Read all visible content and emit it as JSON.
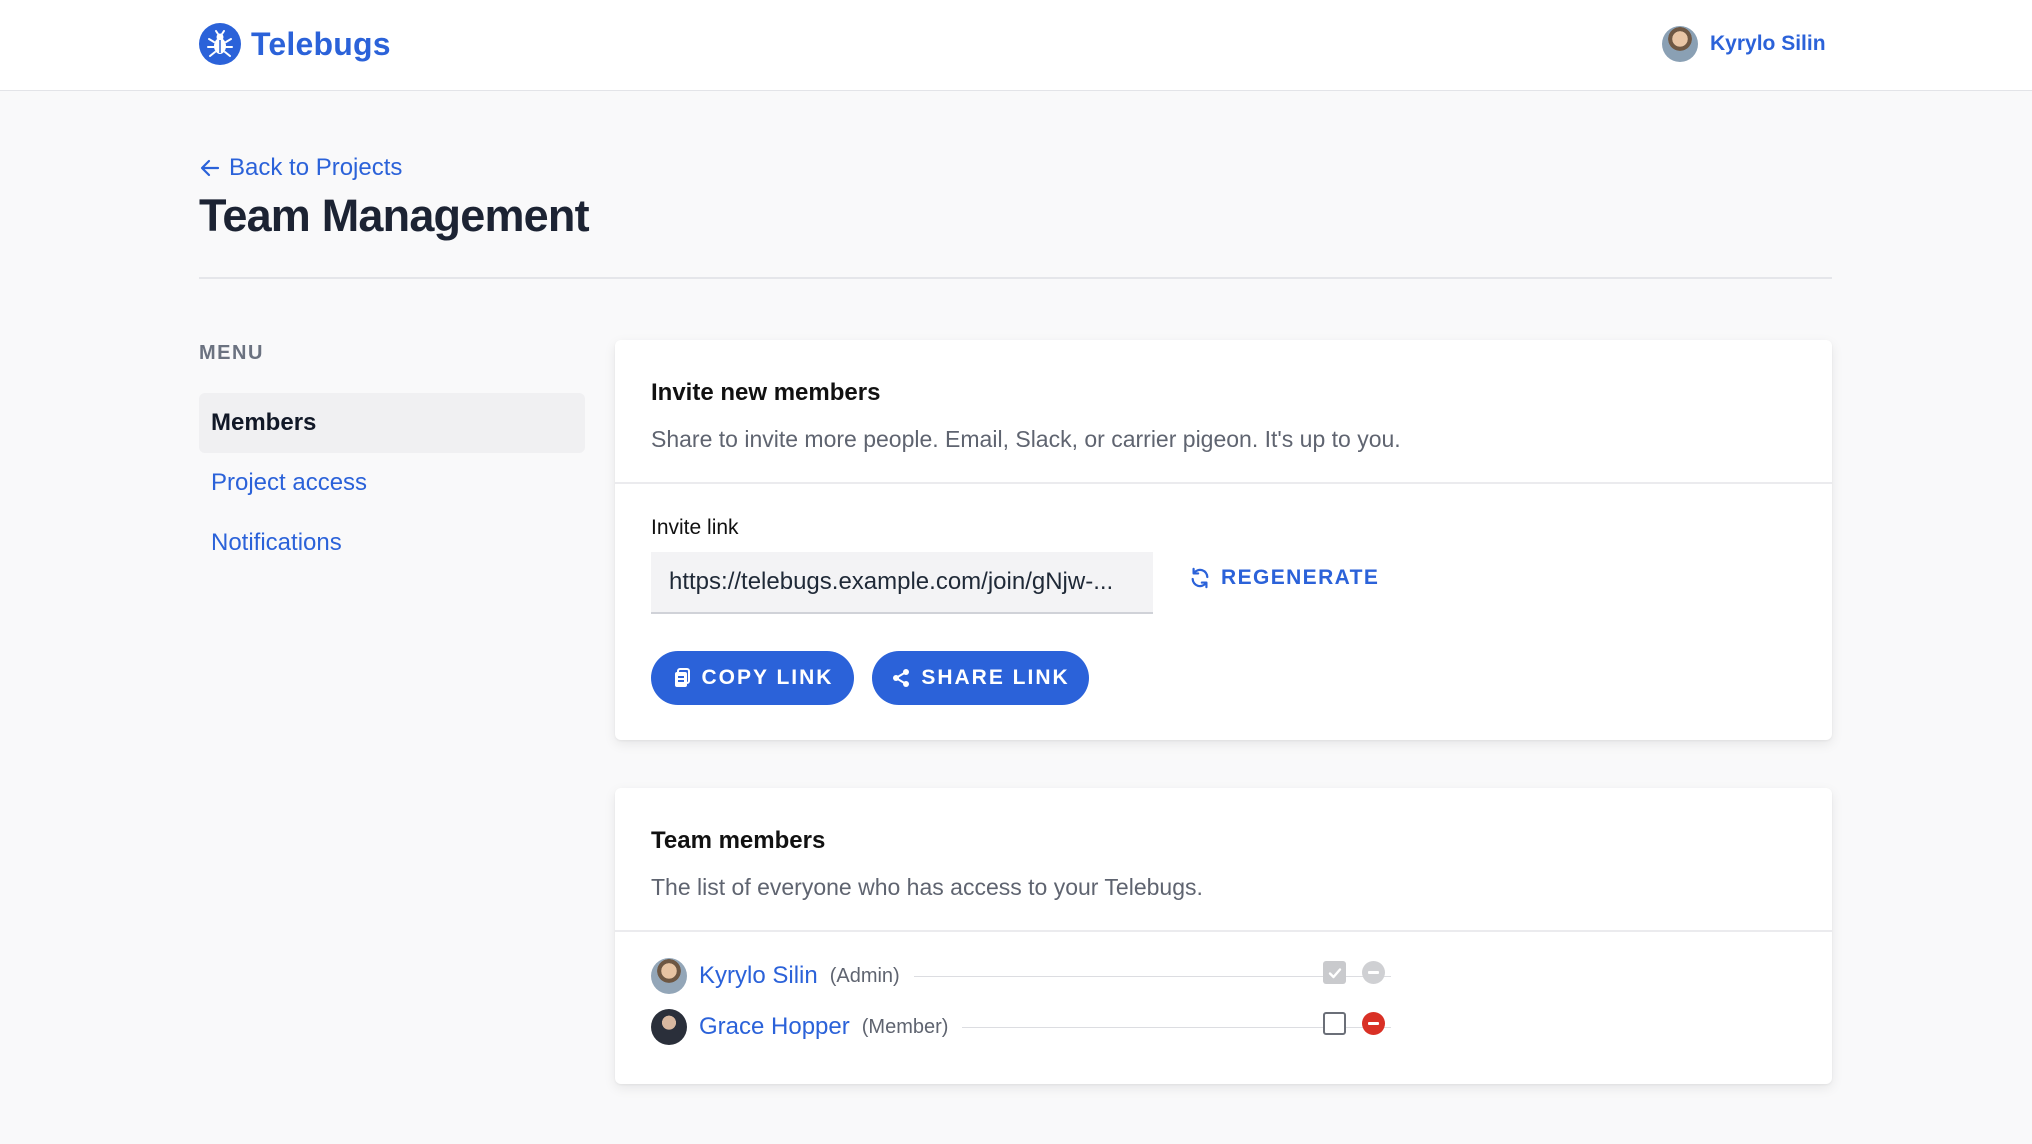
{
  "app": {
    "name": "Telebugs"
  },
  "user": {
    "name": "Kyrylo Silin"
  },
  "nav": {
    "back_label": "Back to Projects"
  },
  "page": {
    "title": "Team Management"
  },
  "menu": {
    "label": "MENU",
    "items": [
      {
        "label": "Members",
        "active": true
      },
      {
        "label": "Project access",
        "active": false
      },
      {
        "label": "Notifications",
        "active": false
      }
    ]
  },
  "invite": {
    "title": "Invite new members",
    "description": "Share to invite more people. Email, Slack, or carrier pigeon. It's up to you.",
    "field_label": "Invite link",
    "link_value": "https://telebugs.example.com/join/gNjw-...",
    "regenerate_label": "REGENERATE",
    "copy_label": "COPY LINK",
    "share_label": "SHARE LINK"
  },
  "team": {
    "title": "Team members",
    "description": "The list of everyone who has access to your Telebugs.",
    "members": [
      {
        "name": "Kyrylo Silin",
        "role": "(Admin)",
        "checked": true,
        "removable": false
      },
      {
        "name": "Grace Hopper",
        "role": "(Member)",
        "checked": false,
        "removable": true
      }
    ]
  },
  "colors": {
    "accent": "#2b62d9",
    "danger": "#d93025",
    "background": "#f9f9fa"
  },
  "icons": {
    "logo": "bug-icon",
    "back": "arrow-left-icon",
    "regenerate": "refresh-icon",
    "copy": "clipboard-icon",
    "share": "share-icon",
    "check": "check-icon",
    "remove": "minus-circle-icon"
  }
}
